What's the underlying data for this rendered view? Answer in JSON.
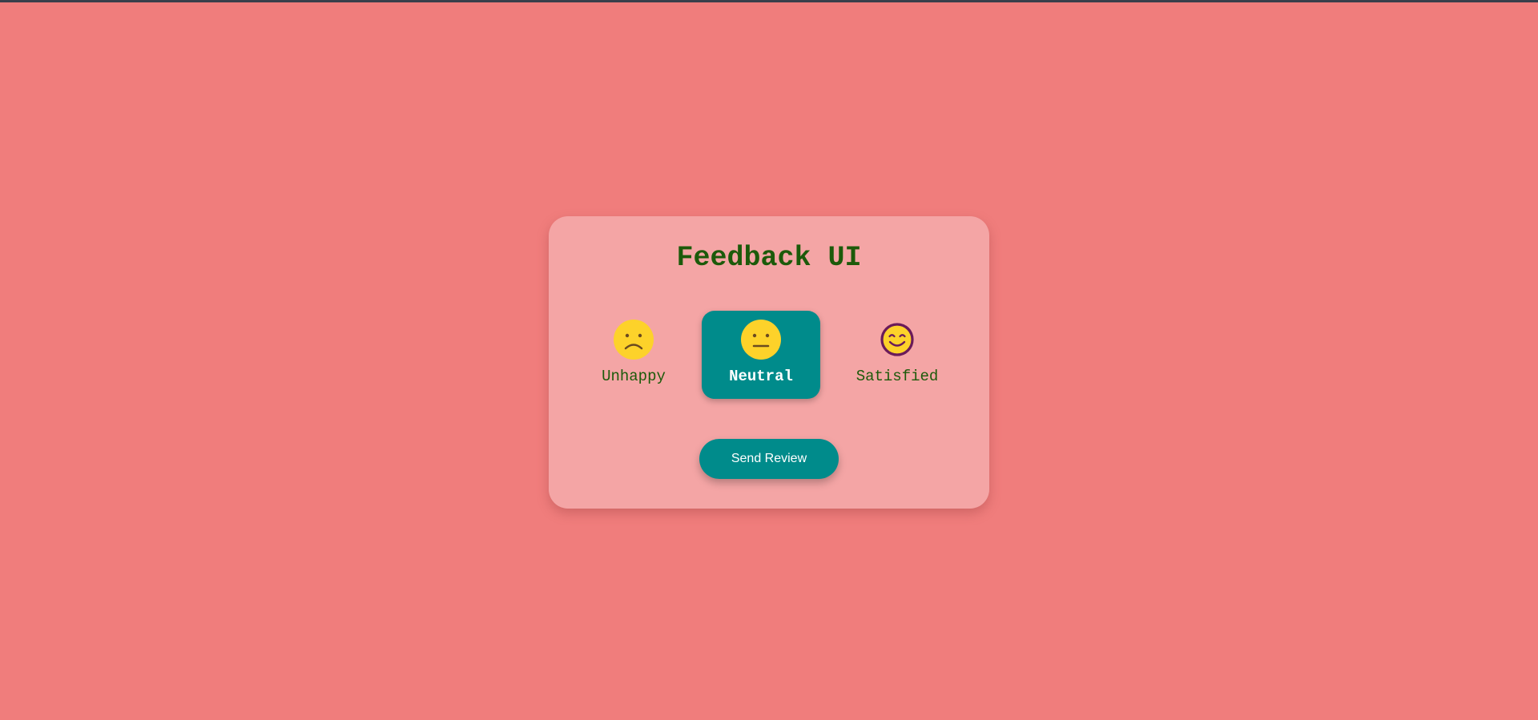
{
  "page": {
    "background_color": "#f07d7c",
    "card_color": "#f4a5a5",
    "accent_color": "#008b8b",
    "text_color": "#1c5a0a"
  },
  "feedback": {
    "title": "Feedback UI",
    "ratings": [
      {
        "label": "Unhappy",
        "icon": "sad-face-icon",
        "selected": false
      },
      {
        "label": "Neutral",
        "icon": "neutral-face-icon",
        "selected": true
      },
      {
        "label": "Satisfied",
        "icon": "smiling-face-icon",
        "selected": false
      }
    ],
    "send_label": "Send Review"
  }
}
